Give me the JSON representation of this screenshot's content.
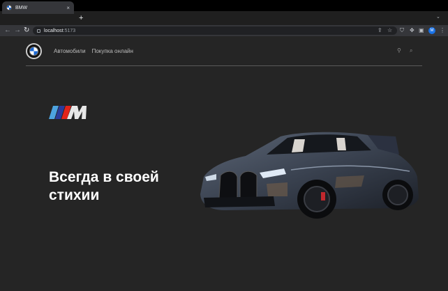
{
  "browser": {
    "tab_title": "BMW",
    "tab_close": "×",
    "new_tab": "+",
    "url_host": "localhost",
    "url_port": ":5173",
    "profile_initial": "M"
  },
  "site": {
    "nav": [
      {
        "label": "Автомобили"
      },
      {
        "label": "Покупка онлайн"
      }
    ],
    "hero": {
      "line1": "Всегда в своей",
      "line2": "стихии"
    }
  },
  "colors": {
    "page_bg": "#252525",
    "m_light_blue": "#4da3e0",
    "m_dark_blue": "#2a3b9b",
    "m_red": "#e2231a"
  }
}
